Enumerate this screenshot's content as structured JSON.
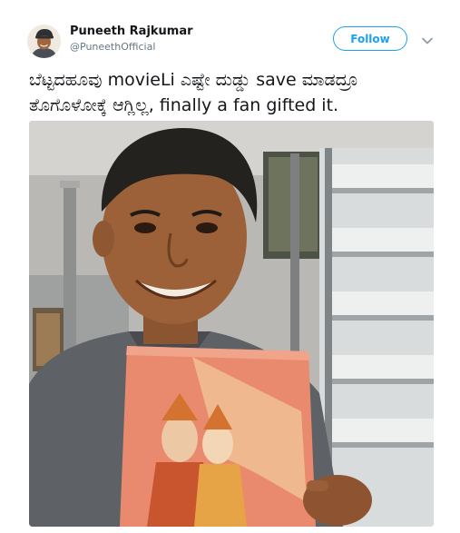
{
  "tweet": {
    "author": {
      "name": "Puneeth Rajkumar",
      "handle": "@PuneethOfficial",
      "avatar_icon": "profile-photo"
    },
    "follow_label": "Follow",
    "menu_icon": "chevron-down-icon",
    "text_lines": [
      "ಬೆಟ್ಟದಹೂವು movieLi ಎಷ್ಟೇ ದುಡ್ಡು save ಮಾಡದ್ರೂ",
      "ತೊಗೊಳೋಕ್ಕೆ ಆಗ್ಲಿಲ್ಲ, finally a fan gifted it."
    ],
    "media": {
      "type": "photo",
      "subject": "man smiling holding a book with an orange cover"
    }
  },
  "colors": {
    "accent": "#1da1f2",
    "text_primary": "#14171a",
    "text_secondary": "#657786",
    "book_cover": "#e98a6e"
  }
}
